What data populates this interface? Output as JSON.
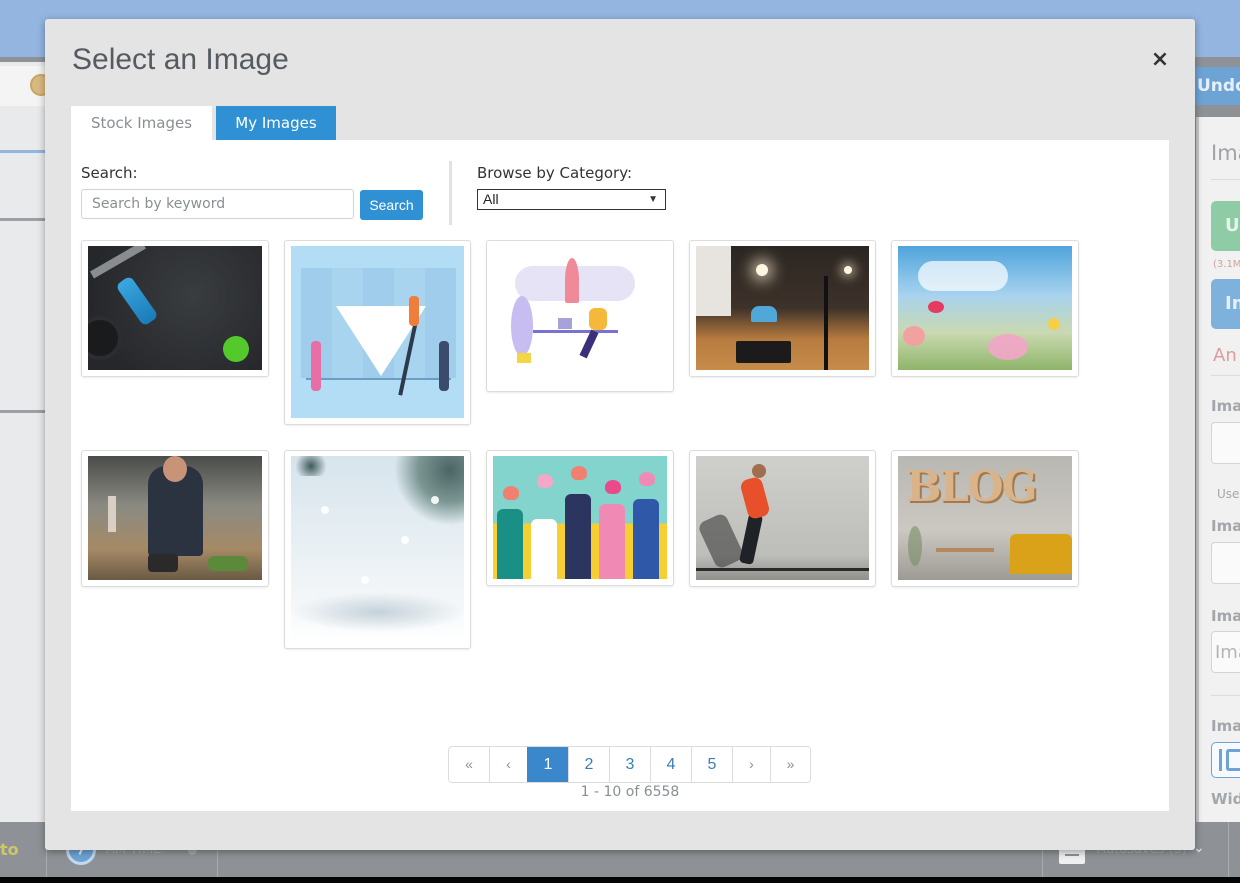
{
  "background_app": {
    "toolbar": {
      "undo_label": "Undo"
    },
    "right_panel": {
      "heading": "Ima",
      "upload_button_label": "Up",
      "size_hint": "(3.1M",
      "image_button_label": "Im",
      "error_text": "An",
      "labels": [
        "Imag",
        "Imag",
        "Imag",
        "Imag",
        "Widt"
      ],
      "use_hint": "Use",
      "input_placeholder": "Ima"
    },
    "bottom_bar": {
      "left_text": "to",
      "time_label": "AM TIME",
      "autosaves_label": "Autosaves (5)"
    }
  },
  "modal": {
    "title": "Select an Image",
    "close_label": "×",
    "tabs": [
      {
        "label": "Stock Images",
        "active": false
      },
      {
        "label": "My Images",
        "active": true
      }
    ],
    "search": {
      "label": "Search:",
      "placeholder": "Search by keyword",
      "value": "",
      "button_label": "Search"
    },
    "category": {
      "label": "Browse by Category:",
      "selected": "All",
      "arrow": "▼"
    },
    "images": [
      {
        "description": "Gym equipment with blue shaker bottle and green kettlebell on dark floor"
      },
      {
        "description": "Illustration of people around a marketing funnel"
      },
      {
        "description": "Illustration of man working at desk with laptop and rocket"
      },
      {
        "description": "Podcast studio with microphone and mixer"
      },
      {
        "description": "Wild flowers under blue sky"
      },
      {
        "description": "Chef cooking in kitchen"
      },
      {
        "description": "Snowy winter background with fir branches"
      },
      {
        "description": "Illustration of raised hands holding hearts"
      },
      {
        "description": "Woman running along concrete wall"
      },
      {
        "description": "Wooden BLOG letters on wall above yellow sofa"
      }
    ],
    "pagination": {
      "first": "«",
      "prev": "‹",
      "pages": [
        "1",
        "2",
        "3",
        "4",
        "5"
      ],
      "current_page": "1",
      "next": "›",
      "last": "»",
      "summary": "1 - 10 of 6558"
    }
  }
}
